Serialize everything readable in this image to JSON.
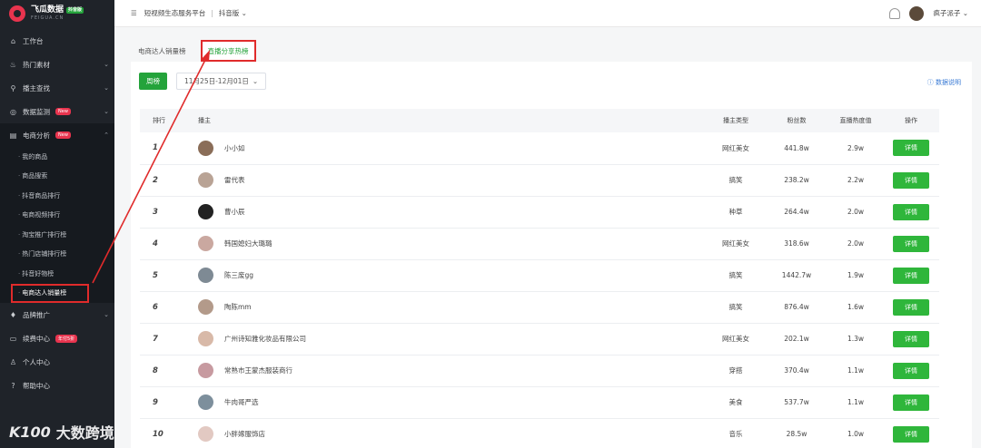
{
  "sidebar": {
    "logo_title": "飞瓜数据",
    "logo_badge": "抖音版",
    "logo_sub": "FEIGUA.CN",
    "items": [
      {
        "icon": "home-icon",
        "glyph": "⌂",
        "label": "工作台"
      },
      {
        "icon": "flame-icon",
        "glyph": "♨",
        "label": "热门素材",
        "chevron": "⌄"
      },
      {
        "icon": "search-icon",
        "glyph": "⚲",
        "label": "播主查找",
        "chevron": "⌄"
      },
      {
        "icon": "monitor-icon",
        "glyph": "◎",
        "label": "数据监测",
        "badge": "New",
        "chevron": "⌄"
      },
      {
        "icon": "chart-icon",
        "glyph": "▤",
        "label": "电商分析",
        "badge": "New",
        "chevron": "⌃"
      }
    ],
    "sub_items": [
      "我的商品",
      "商品搜索",
      "抖音商品排行",
      "电商视频排行",
      "淘宝推广排行榜",
      "热门店铺排行榜",
      "抖音好物榜",
      "电商达人销量榜"
    ],
    "bottom_items": [
      {
        "icon": "diamond-icon",
        "glyph": "♦",
        "label": "品牌推广",
        "chevron": "⌄"
      },
      {
        "icon": "card-icon",
        "glyph": "▭",
        "label": "续费中心",
        "badge": "年付5折"
      },
      {
        "icon": "user-icon",
        "glyph": "♙",
        "label": "个人中心"
      },
      {
        "icon": "help-icon",
        "glyph": "?",
        "label": "帮助中心"
      }
    ],
    "watermark_logo": "K100",
    "watermark_text": "大数跨境"
  },
  "topbar": {
    "menu_glyph": "☰",
    "platform": "短视频生态服务平台",
    "separator": "|",
    "version": "抖音版 ⌄",
    "username": "疯子派子 ⌄"
  },
  "tabs": [
    "电商达人销量榜",
    "直播分享热榜"
  ],
  "toolbar": {
    "week_button": "周榜",
    "date_range": "11月25日-12月01日",
    "date_chevron": "⌄",
    "help": "ⓘ 数据说明"
  },
  "table": {
    "headers": [
      "排行",
      "播主",
      "播主类型",
      "粉丝数",
      "直播热度值",
      "操作"
    ],
    "detail_label": "详情",
    "rows": [
      {
        "rank": "1",
        "name": "小小如",
        "type": "网红美女",
        "fans": "441.8w",
        "heat": "2.9w"
      },
      {
        "rank": "2",
        "name": "雷代表",
        "type": "搞笑",
        "fans": "238.2w",
        "heat": "2.2w"
      },
      {
        "rank": "3",
        "name": "曹小辰",
        "type": "种草",
        "fans": "264.4w",
        "heat": "2.0w"
      },
      {
        "rank": "4",
        "name": "韩国媳妇大璐璐",
        "type": "网红美女",
        "fans": "318.6w",
        "heat": "2.0w"
      },
      {
        "rank": "5",
        "name": "陈三废gg",
        "type": "搞笑",
        "fans": "1442.7w",
        "heat": "1.9w"
      },
      {
        "rank": "6",
        "name": "陶陈mm",
        "type": "搞笑",
        "fans": "876.4w",
        "heat": "1.6w"
      },
      {
        "rank": "7",
        "name": "广州诗知雅化妆品有限公司",
        "type": "网红美女",
        "fans": "202.1w",
        "heat": "1.3w"
      },
      {
        "rank": "8",
        "name": "常熟市王蒙杰服装商行",
        "type": "穿搭",
        "fans": "370.4w",
        "heat": "1.1w"
      },
      {
        "rank": "9",
        "name": "牛肉哥严选",
        "type": "美食",
        "fans": "537.7w",
        "heat": "1.1w"
      },
      {
        "rank": "10",
        "name": "小胖嫁服饰店",
        "type": "音乐",
        "fans": "28.5w",
        "heat": "1.0w"
      }
    ]
  },
  "colors": {
    "accent": "#24a33b",
    "highlight": "#e02b2b",
    "sidebar": "#1f2329"
  }
}
